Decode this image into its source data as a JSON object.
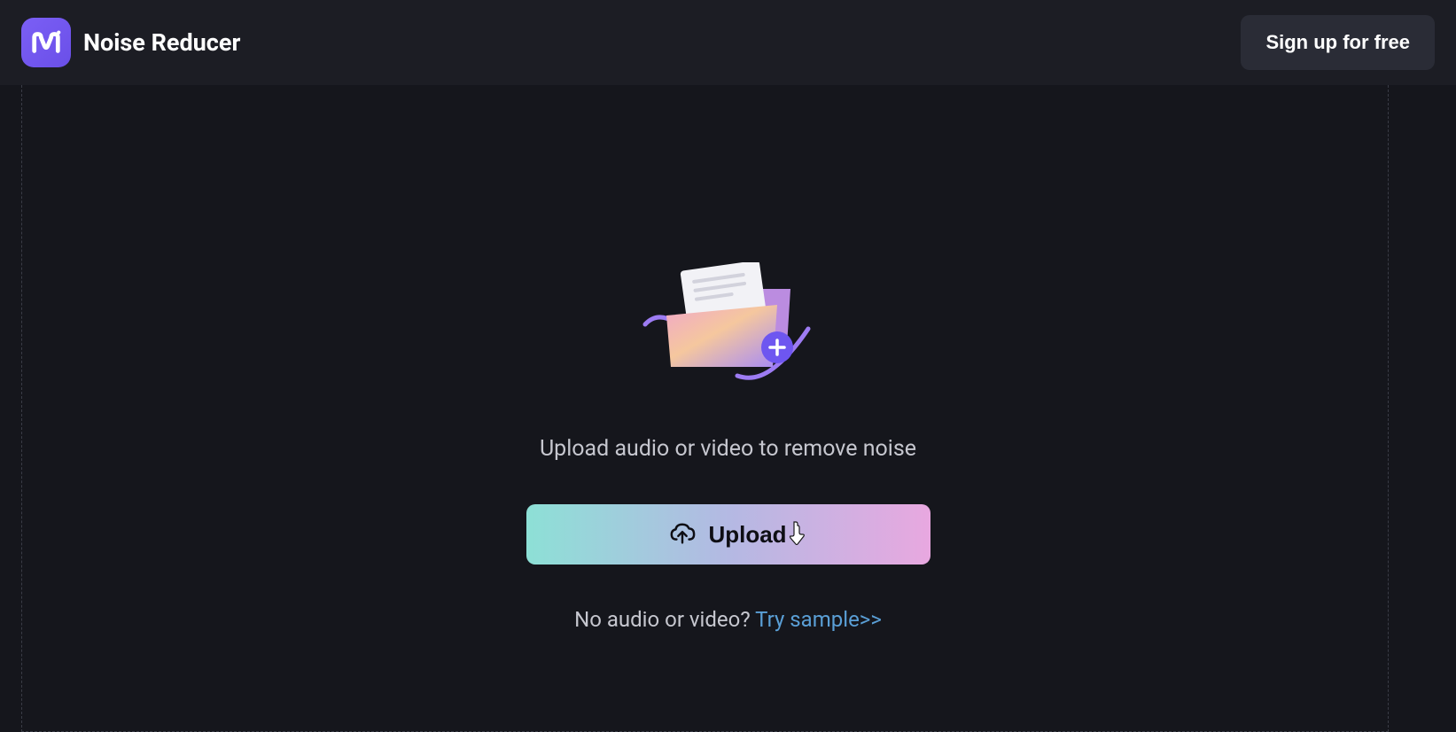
{
  "header": {
    "app_title": "Noise Reducer",
    "signup_label": "Sign up for free"
  },
  "main": {
    "upload_prompt": "Upload audio or video to remove noise",
    "upload_button_label": "Upload",
    "no_media_text": "No audio or video? ",
    "try_sample_label": "Try sample>>"
  },
  "icons": {
    "logo": "m-logo",
    "folder": "folder-add-icon",
    "cloud_upload": "cloud-upload-icon",
    "pointer_cursor": "pointer-cursor-icon"
  },
  "colors": {
    "bg": "#15161c",
    "header_bg": "#1c1d24",
    "accent_purple": "#6a4fe8",
    "gradient_start": "#8de0d6",
    "gradient_end": "#e8a8e0",
    "link": "#5a9fd6"
  }
}
